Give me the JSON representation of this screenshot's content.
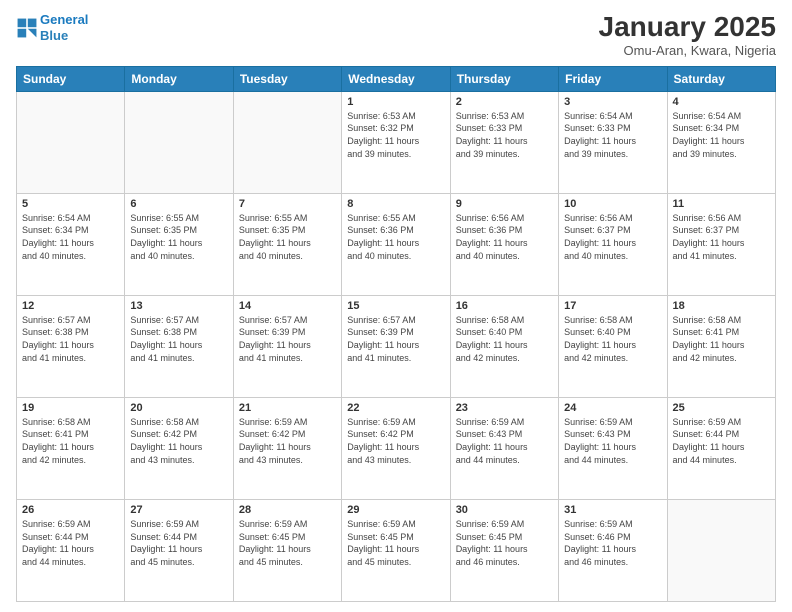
{
  "header": {
    "logo_line1": "General",
    "logo_line2": "Blue",
    "title": "January 2025",
    "subtitle": "Omu-Aran, Kwara, Nigeria"
  },
  "weekdays": [
    "Sunday",
    "Monday",
    "Tuesday",
    "Wednesday",
    "Thursday",
    "Friday",
    "Saturday"
  ],
  "weeks": [
    [
      {
        "day": "",
        "info": ""
      },
      {
        "day": "",
        "info": ""
      },
      {
        "day": "",
        "info": ""
      },
      {
        "day": "1",
        "info": "Sunrise: 6:53 AM\nSunset: 6:32 PM\nDaylight: 11 hours\nand 39 minutes."
      },
      {
        "day": "2",
        "info": "Sunrise: 6:53 AM\nSunset: 6:33 PM\nDaylight: 11 hours\nand 39 minutes."
      },
      {
        "day": "3",
        "info": "Sunrise: 6:54 AM\nSunset: 6:33 PM\nDaylight: 11 hours\nand 39 minutes."
      },
      {
        "day": "4",
        "info": "Sunrise: 6:54 AM\nSunset: 6:34 PM\nDaylight: 11 hours\nand 39 minutes."
      }
    ],
    [
      {
        "day": "5",
        "info": "Sunrise: 6:54 AM\nSunset: 6:34 PM\nDaylight: 11 hours\nand 40 minutes."
      },
      {
        "day": "6",
        "info": "Sunrise: 6:55 AM\nSunset: 6:35 PM\nDaylight: 11 hours\nand 40 minutes."
      },
      {
        "day": "7",
        "info": "Sunrise: 6:55 AM\nSunset: 6:35 PM\nDaylight: 11 hours\nand 40 minutes."
      },
      {
        "day": "8",
        "info": "Sunrise: 6:55 AM\nSunset: 6:36 PM\nDaylight: 11 hours\nand 40 minutes."
      },
      {
        "day": "9",
        "info": "Sunrise: 6:56 AM\nSunset: 6:36 PM\nDaylight: 11 hours\nand 40 minutes."
      },
      {
        "day": "10",
        "info": "Sunrise: 6:56 AM\nSunset: 6:37 PM\nDaylight: 11 hours\nand 40 minutes."
      },
      {
        "day": "11",
        "info": "Sunrise: 6:56 AM\nSunset: 6:37 PM\nDaylight: 11 hours\nand 41 minutes."
      }
    ],
    [
      {
        "day": "12",
        "info": "Sunrise: 6:57 AM\nSunset: 6:38 PM\nDaylight: 11 hours\nand 41 minutes."
      },
      {
        "day": "13",
        "info": "Sunrise: 6:57 AM\nSunset: 6:38 PM\nDaylight: 11 hours\nand 41 minutes."
      },
      {
        "day": "14",
        "info": "Sunrise: 6:57 AM\nSunset: 6:39 PM\nDaylight: 11 hours\nand 41 minutes."
      },
      {
        "day": "15",
        "info": "Sunrise: 6:57 AM\nSunset: 6:39 PM\nDaylight: 11 hours\nand 41 minutes."
      },
      {
        "day": "16",
        "info": "Sunrise: 6:58 AM\nSunset: 6:40 PM\nDaylight: 11 hours\nand 42 minutes."
      },
      {
        "day": "17",
        "info": "Sunrise: 6:58 AM\nSunset: 6:40 PM\nDaylight: 11 hours\nand 42 minutes."
      },
      {
        "day": "18",
        "info": "Sunrise: 6:58 AM\nSunset: 6:41 PM\nDaylight: 11 hours\nand 42 minutes."
      }
    ],
    [
      {
        "day": "19",
        "info": "Sunrise: 6:58 AM\nSunset: 6:41 PM\nDaylight: 11 hours\nand 42 minutes."
      },
      {
        "day": "20",
        "info": "Sunrise: 6:58 AM\nSunset: 6:42 PM\nDaylight: 11 hours\nand 43 minutes."
      },
      {
        "day": "21",
        "info": "Sunrise: 6:59 AM\nSunset: 6:42 PM\nDaylight: 11 hours\nand 43 minutes."
      },
      {
        "day": "22",
        "info": "Sunrise: 6:59 AM\nSunset: 6:42 PM\nDaylight: 11 hours\nand 43 minutes."
      },
      {
        "day": "23",
        "info": "Sunrise: 6:59 AM\nSunset: 6:43 PM\nDaylight: 11 hours\nand 44 minutes."
      },
      {
        "day": "24",
        "info": "Sunrise: 6:59 AM\nSunset: 6:43 PM\nDaylight: 11 hours\nand 44 minutes."
      },
      {
        "day": "25",
        "info": "Sunrise: 6:59 AM\nSunset: 6:44 PM\nDaylight: 11 hours\nand 44 minutes."
      }
    ],
    [
      {
        "day": "26",
        "info": "Sunrise: 6:59 AM\nSunset: 6:44 PM\nDaylight: 11 hours\nand 44 minutes."
      },
      {
        "day": "27",
        "info": "Sunrise: 6:59 AM\nSunset: 6:44 PM\nDaylight: 11 hours\nand 45 minutes."
      },
      {
        "day": "28",
        "info": "Sunrise: 6:59 AM\nSunset: 6:45 PM\nDaylight: 11 hours\nand 45 minutes."
      },
      {
        "day": "29",
        "info": "Sunrise: 6:59 AM\nSunset: 6:45 PM\nDaylight: 11 hours\nand 45 minutes."
      },
      {
        "day": "30",
        "info": "Sunrise: 6:59 AM\nSunset: 6:45 PM\nDaylight: 11 hours\nand 46 minutes."
      },
      {
        "day": "31",
        "info": "Sunrise: 6:59 AM\nSunset: 6:46 PM\nDaylight: 11 hours\nand 46 minutes."
      },
      {
        "day": "",
        "info": ""
      }
    ]
  ]
}
